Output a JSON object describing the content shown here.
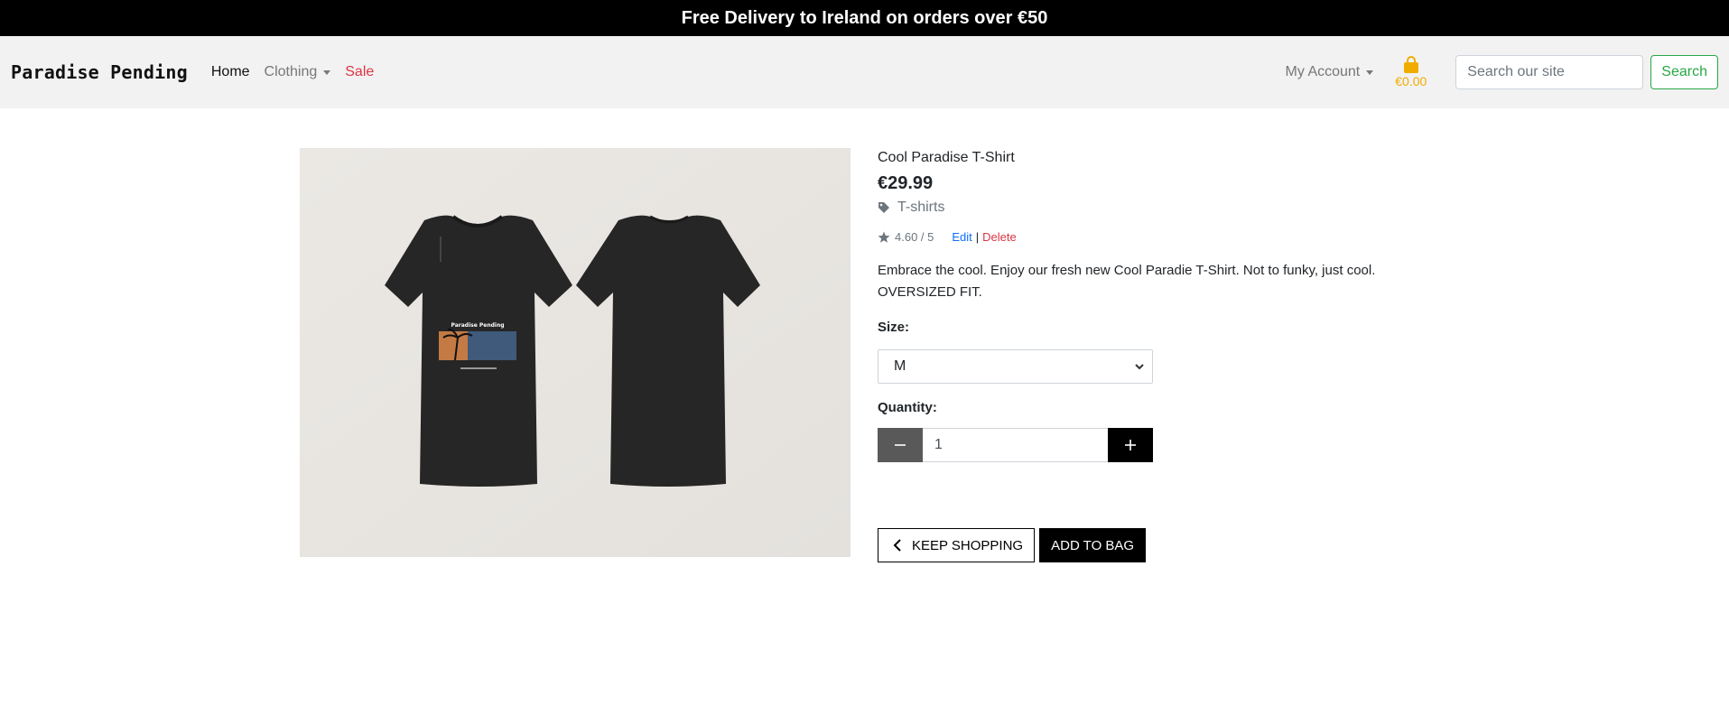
{
  "banner": {
    "text": "Free Delivery to Ireland on orders over €50"
  },
  "navbar": {
    "brand": "Paradise Pending",
    "links": [
      {
        "label": "Home"
      },
      {
        "label": "Clothing"
      },
      {
        "label": "Sale"
      }
    ],
    "account_label": "My Account",
    "bag_total": "€0.00",
    "search_placeholder": "Search our site",
    "search_button": "Search"
  },
  "product": {
    "name": "Cool Paradise T-Shirt",
    "price": "€29.99",
    "category": "T-shirts",
    "rating": "4.60 / 5",
    "edit_label": "Edit",
    "separator": "|",
    "delete_label": "Delete",
    "description_line1": "Embrace the cool. Enjoy our fresh new Cool Paradie T-Shirt. Not to funky, just cool.",
    "description_line2": "OVERSIZED FIT.",
    "size_label": "Size:",
    "size_selected": "M",
    "quantity_label": "Quantity:",
    "quantity_value": "1",
    "image_print_text": "Paradise Pending"
  },
  "actions": {
    "keep_shopping": "KEEP SHOPPING",
    "add_to_bag": "ADD TO BAG"
  },
  "colors": {
    "banner_bg": "#000000",
    "navbar_bg": "#f2f2f2",
    "sale": "#dc3545",
    "bag": "#f0ad00",
    "search_button": "#28a745",
    "edit_link": "#0d6efd",
    "delete_link": "#dc3545"
  },
  "icons": [
    "chevron-down-icon",
    "shopping-bag-icon",
    "tag-icon",
    "star-icon",
    "minus-icon",
    "plus-icon",
    "chevron-left-icon"
  ]
}
